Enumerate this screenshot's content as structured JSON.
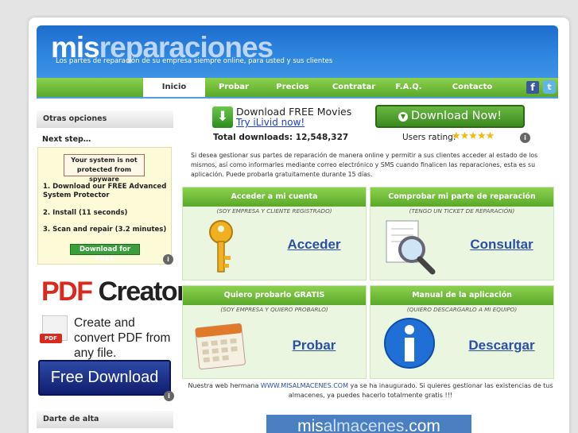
{
  "header": {
    "logo_part1": "mis",
    "logo_part2": "reparaciones",
    "tagline": "Los partes de reparación de su empresa siempre online, para usted y sus clientes"
  },
  "nav": {
    "items": [
      {
        "label": ""
      },
      {
        "label": "Inicio"
      },
      {
        "label": "Probar"
      },
      {
        "label": "Precios"
      },
      {
        "label": "Contratar"
      },
      {
        "label": "F.A.Q."
      },
      {
        "label": "Contacto"
      }
    ]
  },
  "sidebar": {
    "otras": "Otras opciones",
    "next_step": "Next step…",
    "warning": "Your system is not protected from spyware",
    "steps": [
      "1. Download our FREE Advanced System Protector",
      "2. Install (11 seconds)",
      "3. Scan and repair (3.2 minutes)"
    ],
    "dl_btn": "Download for FREE",
    "pdf_part1": "PDF",
    "pdf_part2": " Creator",
    "pdf_tag": "PDF",
    "pdf_text": "Create and convert PDF from any file.",
    "free_download": "Free Download",
    "darte": "Darte de alta"
  },
  "promo": {
    "title": "Download FREE Movies",
    "link": "Try iLivid now!",
    "download_now": "Download Now!",
    "total_label": "Total downloads: 12,548,327",
    "rating_label": "Users rating:",
    "stars": "★★★★★",
    "rating_value": 5
  },
  "intro": "Si desea gestionar sus partes de reparación de manera online y permitir a sus clientes acceder al estado de los mismos, así como informarles mediante correo electrónico y SMS cuando finalicen las reparaciones, esta es su aplicación. Puede probarla gratuitamente durante 15 días.",
  "cards": [
    {
      "title": "Acceder a mi cuenta",
      "subtitle": "(SOY EMPRESA Y CLIENTE REGISTRADO)",
      "link": "Acceder",
      "icon": "key-icon"
    },
    {
      "title": "Comprobar mi parte de reparación",
      "subtitle": "(TENGO UN TICKET DE REPARACIÓN)",
      "link": "Consultar",
      "icon": "magnifier-icon"
    },
    {
      "title": "Quiero probarlo GRATIS",
      "subtitle": "(SOY EMPRESA Y QUIERO PROBARLO)",
      "link": "Probar",
      "icon": "calendar-icon"
    },
    {
      "title": "Manual de la aplicación",
      "subtitle": "(QUIERO DESCARGARLO A MI EQUIPO)",
      "link": "Descargar",
      "icon": "info-icon"
    }
  ],
  "footer": {
    "text_pre": "Nuestra web hermana ",
    "link": "WWW.MISALMACENES.COM",
    "text_post": " ya se ha inaugurado. Si quieres gestionar las existencias de tus almacenes, ya puedes hacerlo totalmente gratis !!!"
  },
  "banner": {
    "part1": "mis",
    "part2": "almacenes",
    "part3": ".com"
  },
  "colors": {
    "nav_green": "#6cbc36",
    "header_blue": "#2e86e0",
    "link_blue": "#2a4fa8"
  }
}
